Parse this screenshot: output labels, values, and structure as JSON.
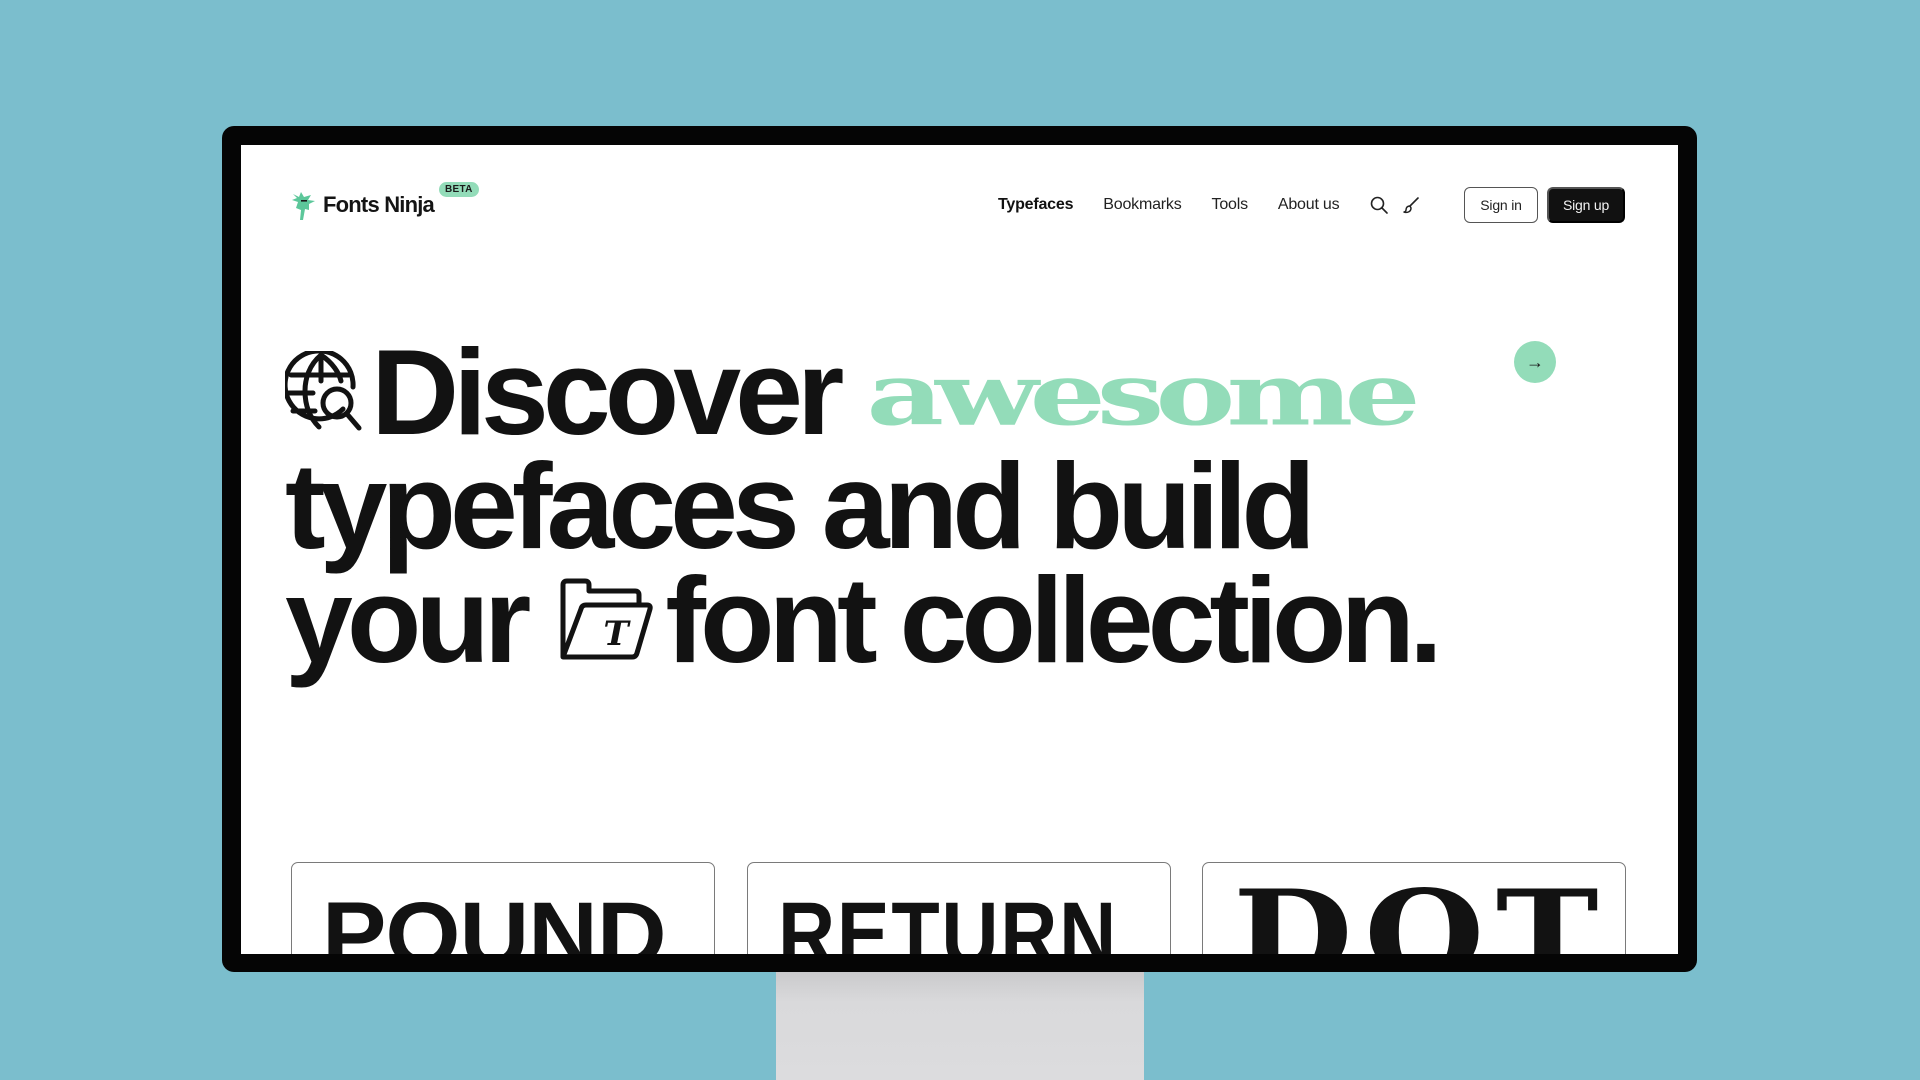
{
  "colors": {
    "background": "#7bbecd",
    "accent_green": "#93dcb9",
    "text_dark": "#121212",
    "frame": "#050505"
  },
  "brand": {
    "name": "Fonts Ninja",
    "badge": "BETA",
    "icon": "ninja-logo-icon"
  },
  "nav": {
    "items": [
      {
        "label": "Typefaces",
        "active": true
      },
      {
        "label": "Bookmarks",
        "active": false
      },
      {
        "label": "Tools",
        "active": false
      },
      {
        "label": "About us",
        "active": false
      }
    ],
    "icons": [
      "search-icon",
      "paintbrush-icon"
    ],
    "sign_in": "Sign in",
    "sign_up": "Sign up"
  },
  "hero": {
    "line1_word": "Discover",
    "line1_highlight": "awesome",
    "line2": "typefaces and build",
    "line3_start": "your",
    "line3_end": "font collection.",
    "arrow": "→",
    "icons": [
      "globe-search-icon",
      "font-folder-icon"
    ],
    "folder_glyph": "T"
  },
  "cards": [
    {
      "word": "POUND"
    },
    {
      "word": "RETURN"
    },
    {
      "word": "DOT"
    }
  ]
}
